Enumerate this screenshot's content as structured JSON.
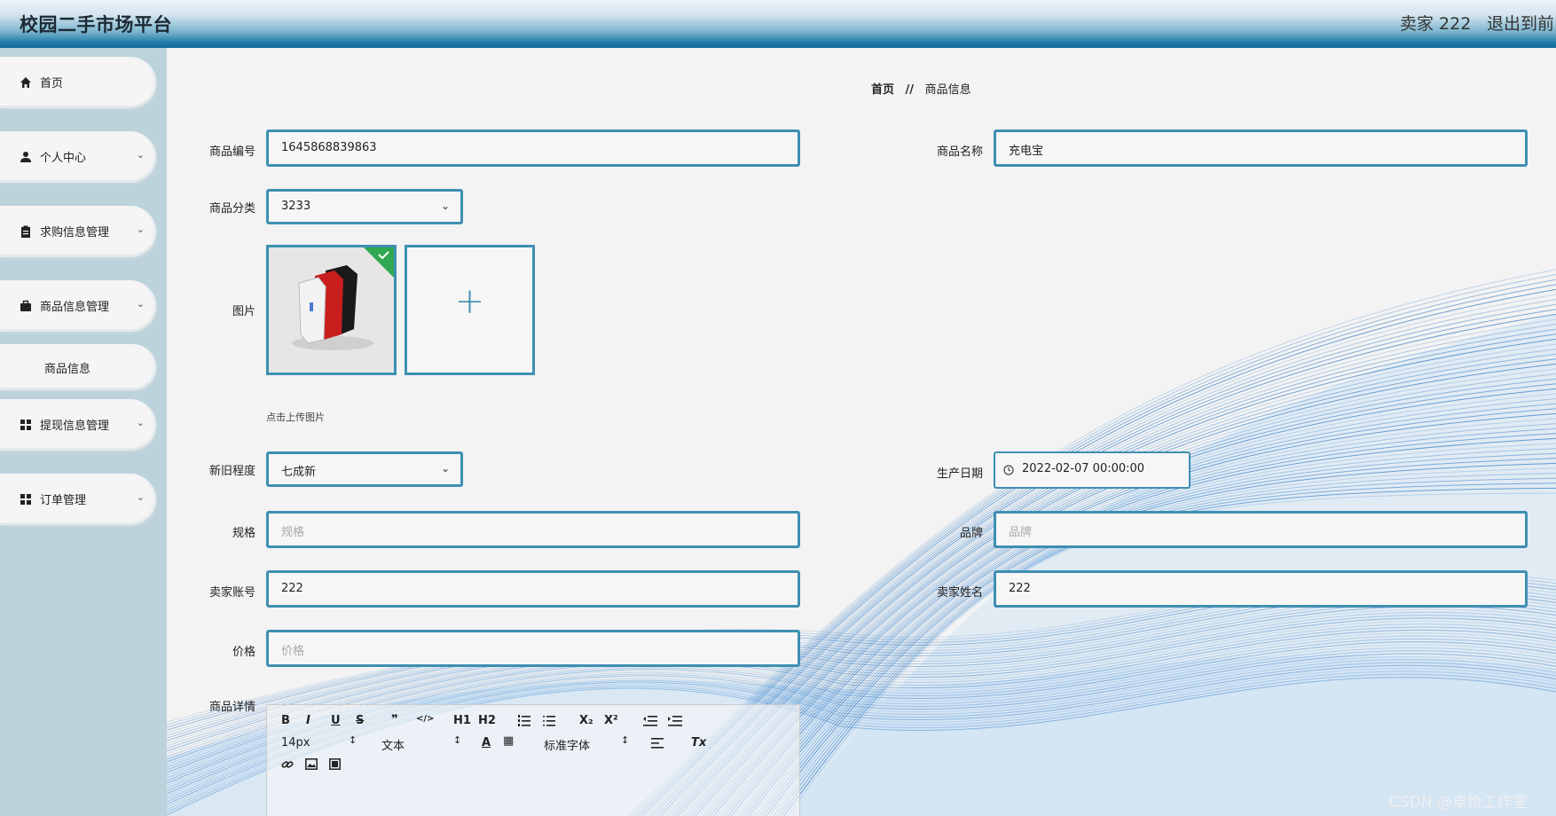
{
  "app": {
    "title": "校园二手市场平台"
  },
  "header": {
    "user": "卖家 222",
    "exit": "退出到前台"
  },
  "sidebar": {
    "items": [
      {
        "label": "首页",
        "icon": "home-icon"
      },
      {
        "label": "个人中心",
        "icon": "user-icon",
        "chevron": "chevron-down-icon"
      },
      {
        "label": "求购信息管理",
        "icon": "clipboard-icon",
        "chevron": "chevron-down-icon"
      },
      {
        "label": "商品信息管理",
        "icon": "briefcase-icon",
        "chevron": "chevron-down-icon"
      },
      {
        "label": "商品信息"
      },
      {
        "label": "提现信息管理",
        "icon": "grid-icon",
        "chevron": "chevron-down-icon"
      },
      {
        "label": "订单管理",
        "icon": "grid-icon",
        "chevron": "chevron-down-icon"
      }
    ]
  },
  "breadcrumb": {
    "home": "首页",
    "sep": "//",
    "current": "商品信息"
  },
  "form": {
    "code": {
      "label": "商品编号",
      "value": "1645868839863"
    },
    "name": {
      "label": "商品名称",
      "value": "充电宝"
    },
    "category": {
      "label": "商品分类",
      "value": "3233"
    },
    "image": {
      "label": "图片",
      "tip": "点击上传图片",
      "add": "+"
    },
    "condition": {
      "label": "新旧程度",
      "value": "七成新"
    },
    "date": {
      "label": "生产日期",
      "value": "2022-02-07 00:00:00"
    },
    "spec": {
      "label": "规格",
      "placeholder": "规格"
    },
    "brand": {
      "label": "品牌",
      "placeholder": "品牌"
    },
    "seller_account": {
      "label": "卖家账号",
      "value": "222"
    },
    "seller_name": {
      "label": "卖家姓名",
      "value": "222"
    },
    "price": {
      "label": "价格",
      "placeholder": "价格"
    },
    "details": {
      "label": "商品详情"
    }
  },
  "editor": {
    "font_size": "14px",
    "paragraph": "文本",
    "font_family": "标准字体",
    "buttons": {
      "bold": "B",
      "italic": "I",
      "underline": "U",
      "strike": "S",
      "quote": "❞",
      "code": "</>",
      "h1": "H1",
      "h2": "H2",
      "sub": "X₂",
      "sup": "X²",
      "color": "A",
      "clean": "Tx"
    }
  },
  "watermark": "CSDN @卓怡工作室",
  "colors": {
    "accent": "#3e8fb2",
    "sidebar_bg": "#bcd3dc",
    "wave": "#1f6fc0"
  }
}
